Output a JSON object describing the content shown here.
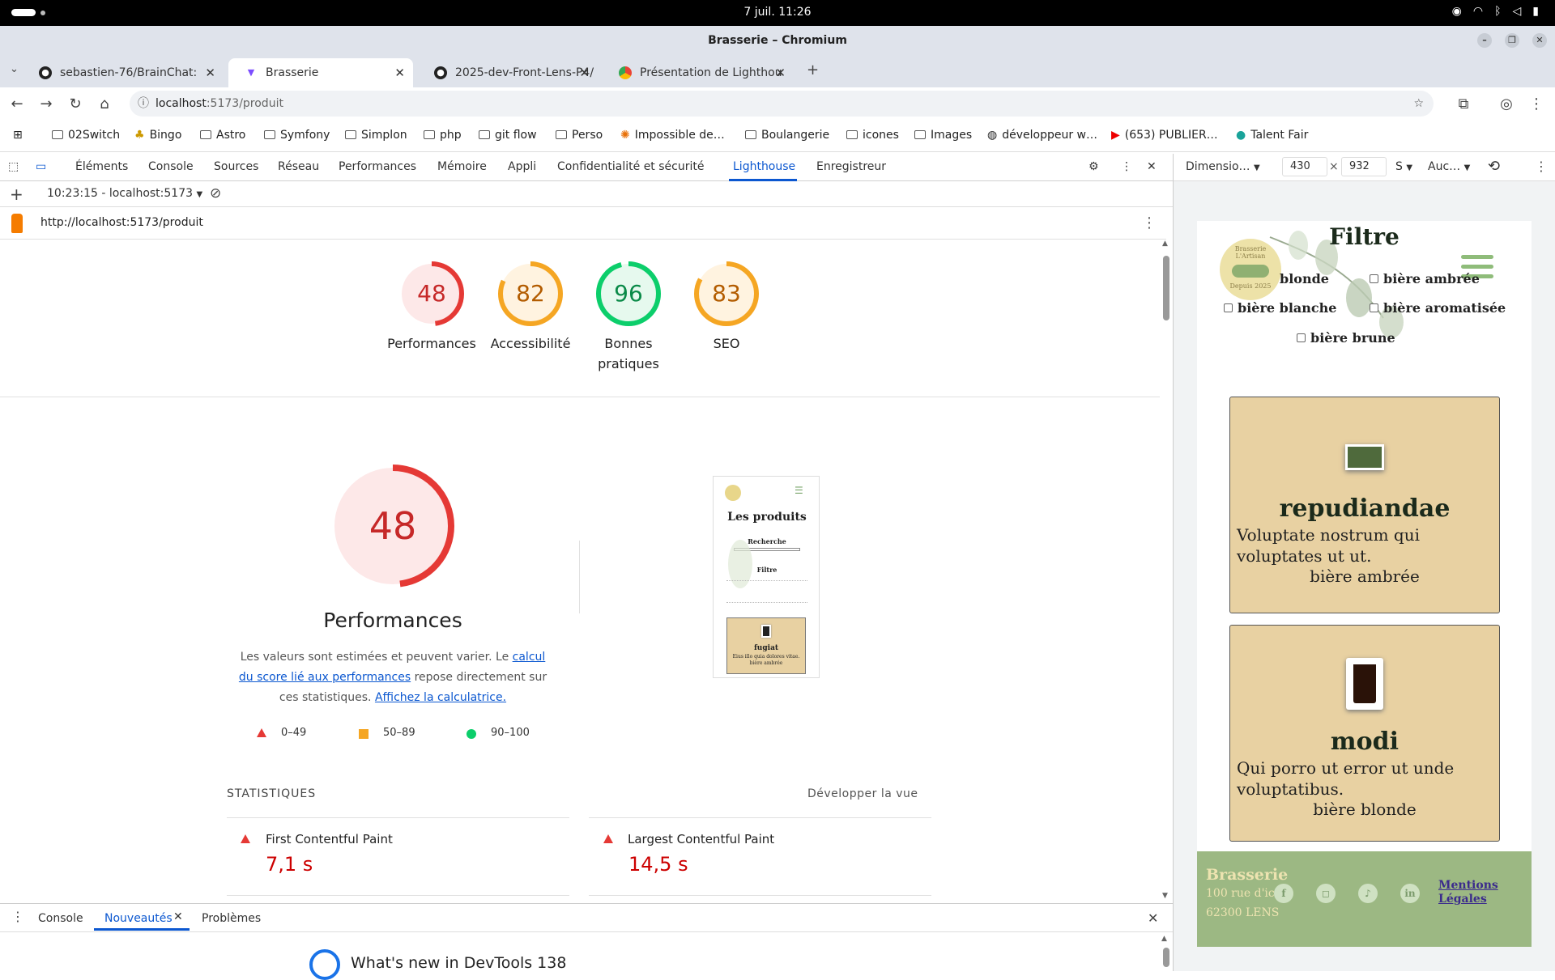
{
  "os": {
    "clock": "7 juil.  11:26"
  },
  "window": {
    "title": "Brasserie – Chromium",
    "min": "–",
    "max": "❐",
    "close": "✕"
  },
  "tabs": [
    {
      "label": "sebastien-76/BrainChat:",
      "icon": "github-icon"
    },
    {
      "label": "Brasserie",
      "icon": "vite-icon"
    },
    {
      "label": "2025-dev-Front-Lens-P4/",
      "icon": "github-icon"
    },
    {
      "label": "Présentation de Lighthou",
      "icon": "chrome-icon"
    }
  ],
  "tab_close": "✕",
  "new_tab": "+",
  "address": {
    "host": "localhost",
    "path": ":5173/produit"
  },
  "bookmarks": [
    "02Switch",
    "Bingo",
    "Astro",
    "Symfony",
    "Simplon",
    "php",
    "git flow",
    "Perso",
    "Impossible de…",
    "Boulangerie",
    "icones",
    "Images",
    "développeur w…",
    "(653) PUBLIER…",
    "Talent Fair"
  ],
  "devtools": {
    "tabs": [
      "Éléments",
      "Console",
      "Sources",
      "Réseau",
      "Performances",
      "Mémoire",
      "Appli",
      "Confidentialité et sécurité",
      "Lighthouse",
      "Enregistreur"
    ],
    "active_tab": "Lighthouse",
    "report_select": "10:23:15 - localhost:5173",
    "report_url": "http://localhost:5173/produit"
  },
  "scores": [
    {
      "value": 48,
      "label": "Performances",
      "color": "#e53935",
      "bg": "#fde8e8"
    },
    {
      "value": 82,
      "label": "Accessibilité",
      "color": "#f5a623",
      "bg": "#fff3e0"
    },
    {
      "value": 96,
      "label": "Bonnes pratiques",
      "color": "#0cce6b",
      "bg": "#e6f9ee"
    },
    {
      "value": 83,
      "label": "SEO",
      "color": "#f5a623",
      "bg": "#fff3e0"
    }
  ],
  "performance": {
    "score": 48,
    "title": "Performances",
    "desc1": "Les valeurs sont estimées et peuvent varier. Le ",
    "link1": "calcul du score lié aux performances",
    "desc2": " repose directement sur ces statistiques. ",
    "link2": "Affichez la calculatrice.",
    "legend": [
      "0–49",
      "50–89",
      "90–100"
    ]
  },
  "thumb": {
    "title": "Les produits",
    "search": "Recherche",
    "filter": "Filtre",
    "product": "fugiat",
    "desc": "Eius illo quia dolores vitae.",
    "type": "bière ambrée"
  },
  "stats": {
    "title": "STATISTIQUES",
    "expand": "Développer la vue",
    "metrics": [
      {
        "name": "First Contentful Paint",
        "value": "7,1 s"
      },
      {
        "name": "Largest Contentful Paint",
        "value": "14,5 s"
      }
    ]
  },
  "drawer": {
    "tabs": [
      "Console",
      "Nouveautés",
      "Problèmes"
    ],
    "active": "Nouveautés",
    "headline": "What's new in DevTools 138"
  },
  "device_toolbar": {
    "preset": "Dimensio…",
    "width": "430",
    "times": "×",
    "height": "932",
    "dpr": "S",
    "throttle": "Auc…"
  },
  "phone": {
    "filter_title": "Filtre",
    "logo_top": "Brasserie L'Artisan",
    "logo_bottom": "Depuis 2025",
    "filters": [
      "blonde",
      "bière ambrée",
      "bière blanche",
      "bière aromatisée",
      "bière brune"
    ],
    "products": [
      {
        "name": "repudiandae",
        "desc": "Voluptate nostrum qui voluptates ut ut.",
        "type": "bière ambrée"
      },
      {
        "name": "modi",
        "desc": "Qui porro ut error ut unde voluptatibus.",
        "type": "bière blonde"
      }
    ],
    "footer": {
      "brand": "Brasserie",
      "street": "100 rue d'ici",
      "city": "62300 LENS",
      "legal": "Mentions Légales"
    }
  }
}
